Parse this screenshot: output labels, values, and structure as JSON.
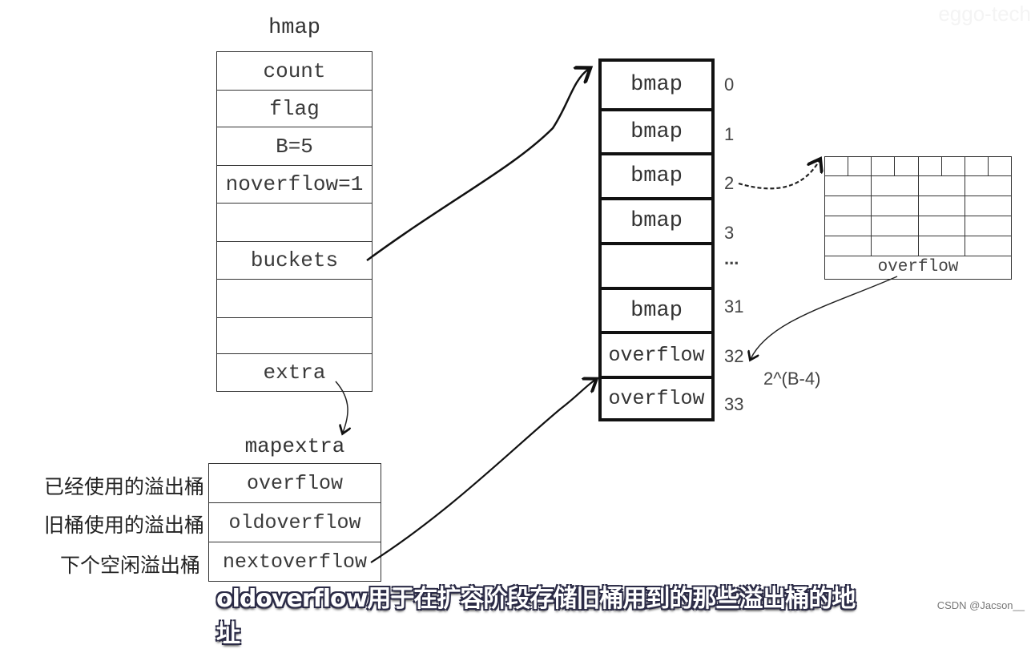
{
  "watermark_logo": "eggo-tech",
  "hmap": {
    "title": "hmap",
    "fields": [
      "count",
      "flag",
      "B=5",
      "noverflow=1",
      "",
      "buckets",
      "",
      "",
      "extra"
    ]
  },
  "mapextra": {
    "title": "mapextra",
    "fields": [
      "overflow",
      "oldoverflow",
      "nextoverflow"
    ],
    "descriptions": [
      "已经使用的溢出桶",
      "旧桶使用的溢出桶",
      "下个空闲溢出桶"
    ]
  },
  "buckets_array": {
    "cells": [
      {
        "label": "bmap",
        "index": "0"
      },
      {
        "label": "bmap",
        "index": "1"
      },
      {
        "label": "bmap",
        "index": "2"
      },
      {
        "label": "bmap",
        "index": "3"
      },
      {
        "label": "",
        "index": "..."
      },
      {
        "label": "bmap",
        "index": "31"
      },
      {
        "label": "overflow",
        "index": "32"
      },
      {
        "label": "overflow",
        "index": "33"
      }
    ],
    "overflow_count_note": "2^(B-4)"
  },
  "bmap_detail": {
    "tophash_slots": 8,
    "kv_rows": 4,
    "kv_cols": 4,
    "overflow_label": "overflow"
  },
  "subtitle": "oldoverflow用于在扩容阶段存储旧桶用到的那些溢出桶的地址",
  "credit": "CSDN @Jacson__"
}
